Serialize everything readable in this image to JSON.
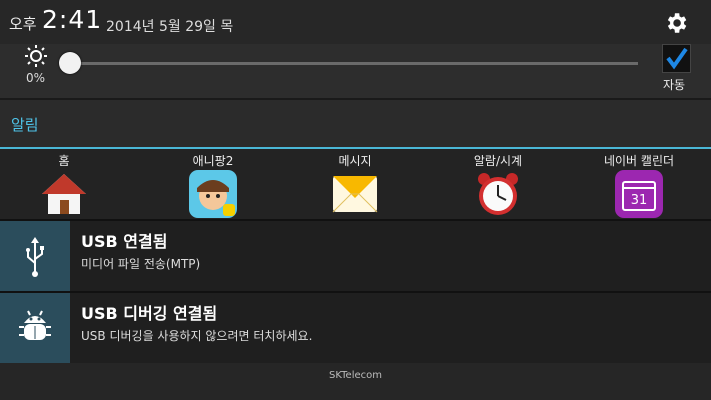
{
  "header": {
    "ampm": "오후",
    "time": "2:41",
    "date": "2014년 5월 29일 목"
  },
  "brightness": {
    "percent_label": "0%",
    "level": 0.0,
    "auto_label": "자동"
  },
  "alerts": {
    "label": "알림"
  },
  "apps": [
    {
      "label": "홈",
      "icon": "home-icon"
    },
    {
      "label": "애니팡2",
      "icon": "anipang-icon"
    },
    {
      "label": "메시지",
      "icon": "message-icon"
    },
    {
      "label": "알람/시계",
      "icon": "alarm-clock-icon"
    },
    {
      "label": "네이버 캘린더",
      "icon": "calendar-icon",
      "calendar_day": "31"
    }
  ],
  "notifications": [
    {
      "title": "USB 연결됨",
      "subtitle": "미디어 파일 전송(MTP)",
      "icon": "usb-icon"
    },
    {
      "title": "USB 디버깅 연결됨",
      "subtitle": "USB 디버깅을 사용하지 않으려면 터치하세요.",
      "icon": "debug-bug-icon"
    }
  ],
  "footer": {
    "carrier": "SKTelecom"
  },
  "colors": {
    "accent": "#4fc3e8",
    "notif_icon_bg": "#2b4d5c",
    "auto_check": "#1e88e5"
  }
}
